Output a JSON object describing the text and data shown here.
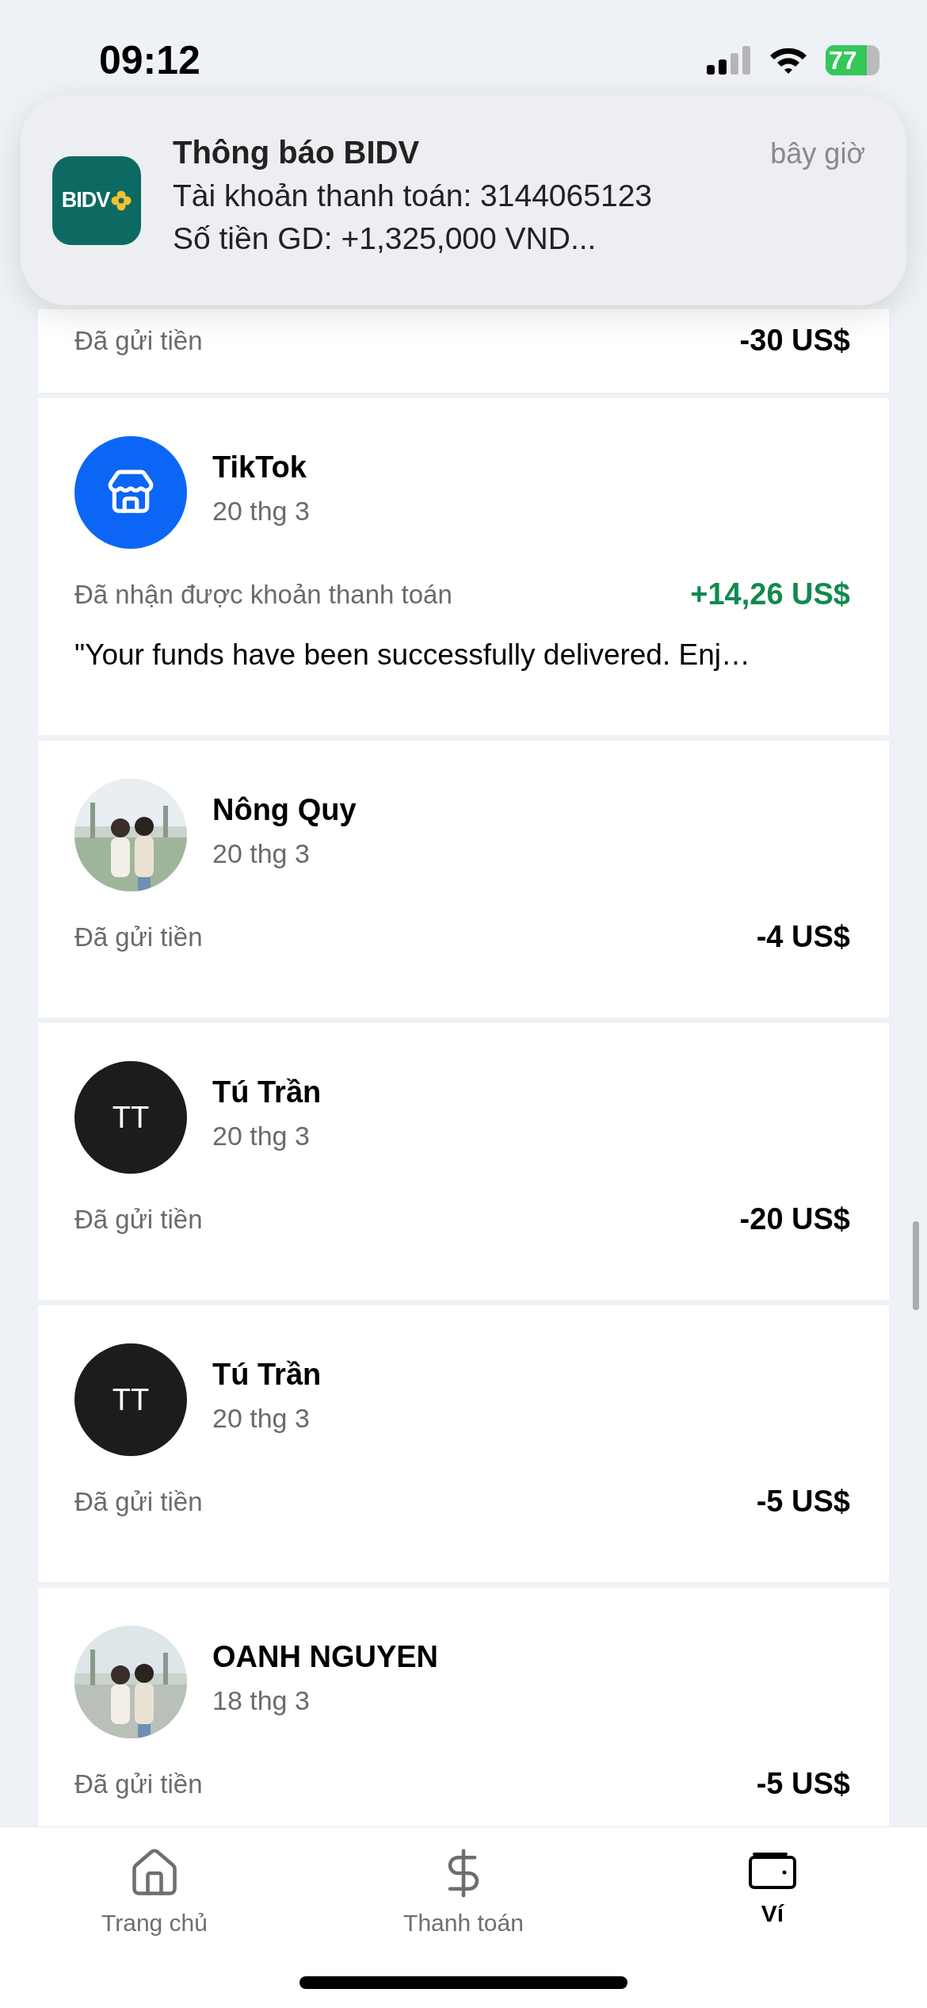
{
  "status_bar": {
    "time": "09:12",
    "battery": "77"
  },
  "notification": {
    "app_logo": "BIDV",
    "title": "Thông báo BIDV",
    "time": "bây giờ",
    "lines": [
      "Tài khoản thanh toán: 3144065123",
      "Số tiền GD: +1,325,000 VND..."
    ]
  },
  "transactions": [
    {
      "kind": "partial",
      "status": "Đã gửi tiền",
      "amount": "-30 US$",
      "color": "#000000"
    },
    {
      "kind": "full",
      "avatar": {
        "kind": "merchant"
      },
      "name": "TikTok",
      "date": "20 thg 3",
      "status": "Đã nhận được khoản thanh toán",
      "amount": "+14,26 US$",
      "color": "#0f8a4f",
      "message": "\"Your funds have been successfully delivered. Enj…"
    },
    {
      "kind": "full",
      "name": "Nông Quy",
      "date": "20 thg 3",
      "status": "Đã gửi tiền",
      "amount": "-4 US$",
      "color": "#000000"
    },
    {
      "kind": "full",
      "avatar": {
        "kind": "initials",
        "initials": "TT"
      },
      "name": "Tú Trần",
      "date": "20 thg 3",
      "status": "Đã gửi tiền",
      "amount": "-20 US$",
      "color": "#000000"
    },
    {
      "kind": "full",
      "avatar": {
        "kind": "initials",
        "initials": "TT"
      },
      "name": "Tú Trần",
      "date": "20 thg 3",
      "status": "Đã gửi tiền",
      "amount": "-5 US$",
      "color": "#000000"
    },
    {
      "kind": "full",
      "name": "OANH NGUYEN",
      "date": "18 thg 3",
      "status": "Đã gửi tiền",
      "amount": "-5 US$",
      "color": "#000000"
    }
  ],
  "nav": [
    {
      "label": "Trang chủ",
      "kind": "home",
      "selected": false
    },
    {
      "label": "Thanh toán",
      "kind": "payment",
      "selected": false
    },
    {
      "label": "Ví",
      "kind": "wallet",
      "selected": true
    }
  ]
}
